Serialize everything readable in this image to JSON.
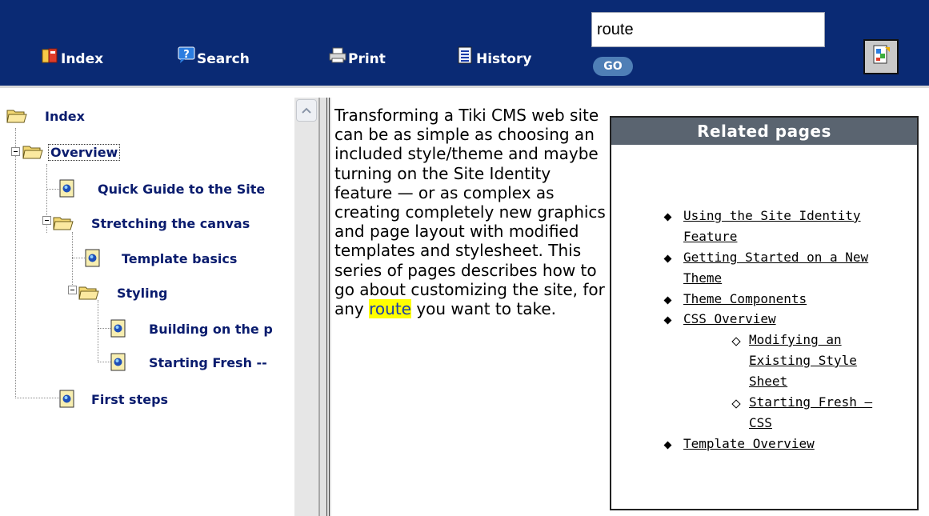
{
  "toolbar": {
    "index_label": "Index",
    "search_label": "Search",
    "print_label": "Print",
    "history_label": "History",
    "search_value": "route",
    "go_label": "GO",
    "icons": [
      "book-icon",
      "help-search-icon",
      "printer-icon",
      "history-list-icon",
      "sync-icon"
    ]
  },
  "tree": {
    "root": "Index",
    "items": [
      {
        "label": "Overview"
      },
      {
        "label": "Quick Guide to the Site"
      },
      {
        "label": "Stretching the canvas"
      },
      {
        "label": "Template basics"
      },
      {
        "label": "Styling"
      },
      {
        "label": "Building on the p"
      },
      {
        "label": "Starting Fresh --"
      },
      {
        "label": "First steps"
      }
    ]
  },
  "content": {
    "text_before": "Transforming a Tiki CMS web site can be as simple as choosing an included style/theme and maybe turning on the Site Identity feature — or as complex as creating completely new graphics and page layout with modified templates and stylesheet. This series of pages describes how to go about customizing the site, for any ",
    "highlight": "route",
    "text_after": " you want to take."
  },
  "related": {
    "title": "Related pages",
    "items": [
      {
        "line1": "Using the Site Identity",
        "line2": "Feature"
      },
      {
        "line1": "Getting Started on a New",
        "line2": "Theme"
      },
      {
        "line1": "Theme Components"
      },
      {
        "line1": "CSS Overview"
      },
      {
        "line1": "Modifying an",
        "line2": "Existing Style",
        "line3": "Sheet"
      },
      {
        "line1": "Starting Fresh —",
        "line2": "CSS"
      },
      {
        "line1": "Template Overview"
      }
    ]
  }
}
